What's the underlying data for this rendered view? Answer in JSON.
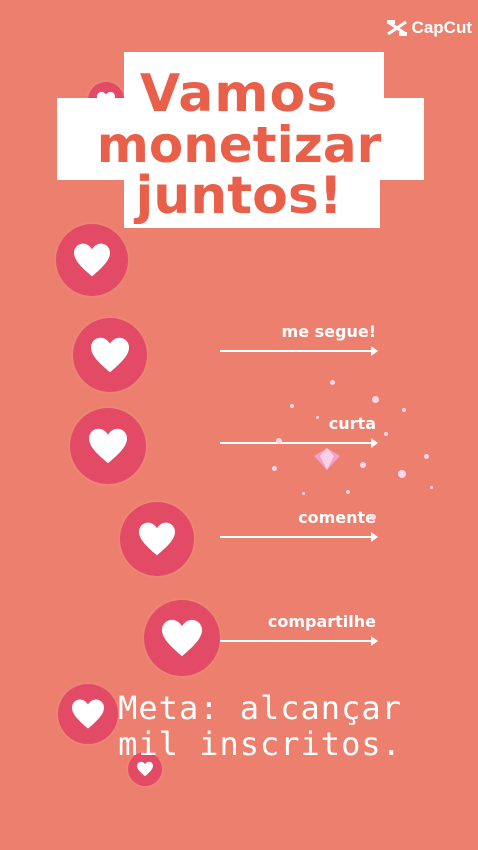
{
  "watermark": {
    "text": "CapCut",
    "icon": "capcut-logo-icon"
  },
  "title": {
    "line1": "Vamos",
    "line2": "monetizar",
    "line3": "juntos!"
  },
  "steps": [
    {
      "label": "me segue!"
    },
    {
      "label": "curta"
    },
    {
      "label": "comente"
    },
    {
      "label": "compartilhe"
    }
  ],
  "goal": {
    "line1": "Meta: alcançar",
    "line2": "mil inscritos."
  },
  "colors": {
    "background": "#ec7f6d",
    "heart_circle": "#e34a66",
    "title_text": "#e8604a",
    "white": "#ffffff"
  },
  "icons": [
    "heart-icon",
    "sparkle-icon",
    "arrow-icon"
  ]
}
